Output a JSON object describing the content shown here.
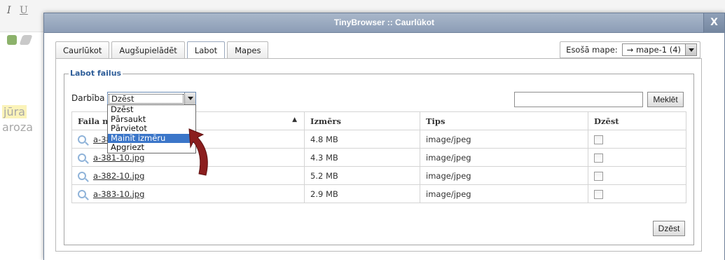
{
  "window": {
    "title": "TinyBrowser :: Caurlūkot",
    "close_label": "X"
  },
  "background": {
    "italic_label": "I",
    "underline_label": "U",
    "text_line1": "jūra",
    "text_line2": "aroza"
  },
  "tabs": [
    {
      "label": "Caurlūkot"
    },
    {
      "label": "Augšupielādēt"
    },
    {
      "label": "Labot",
      "active": true
    },
    {
      "label": "Mapes"
    }
  ],
  "folder_select": {
    "label": "Esošā mape:",
    "value": "→ mape-1 (4)"
  },
  "panel": {
    "legend": "Labot failus",
    "action_label": "Darbība",
    "action_value": "Dzēst",
    "action_options": [
      "Dzēst",
      "Pārsaukt",
      "Pārvietot",
      "Mainīt izmēru",
      "Apgriezt"
    ],
    "action_selected_index": 3,
    "search_placeholder": "",
    "search_button": "Meklēt",
    "delete_button": "Dzēst"
  },
  "table": {
    "headers": [
      "Faila nosaukums",
      "Izmērs",
      "Tips",
      "Dzēst"
    ],
    "sort_indicator": "▲",
    "rows": [
      {
        "name": "a-380-10.jpg",
        "size": "4.8 MB",
        "type": "image/jpeg"
      },
      {
        "name": "a-381-10.jpg",
        "size": "4.3 MB",
        "type": "image/jpeg"
      },
      {
        "name": "a-382-10.jpg",
        "size": "5.2 MB",
        "type": "image/jpeg"
      },
      {
        "name": "a-383-10.jpg",
        "size": "2.9 MB",
        "type": "image/jpeg"
      }
    ]
  },
  "colors": {
    "accent": "#3b76c9",
    "legend": "#2f5e99",
    "annotation_arrow": "#8b1e1e"
  }
}
